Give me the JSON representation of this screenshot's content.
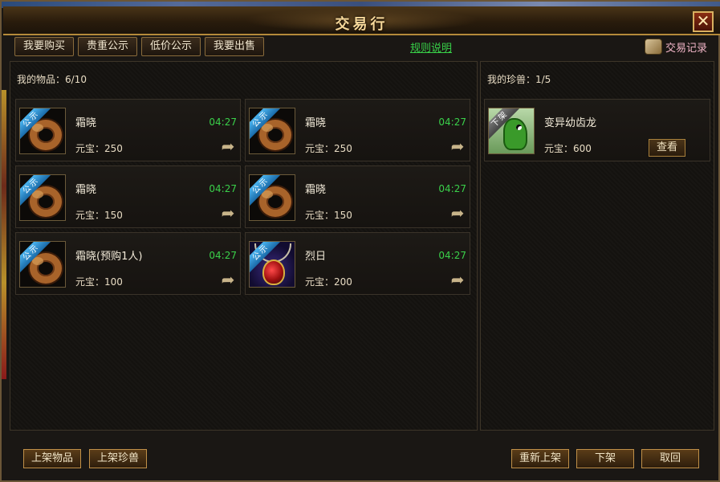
{
  "window": {
    "title": "交易行",
    "close_icon": "close-icon"
  },
  "tabs": [
    {
      "label": "我要购买"
    },
    {
      "label": "贵重公示"
    },
    {
      "label": "低价公示"
    },
    {
      "label": "我要出售"
    }
  ],
  "rules_link": "规则说明",
  "records_label": "交易记录",
  "my_items": {
    "header": "我的物品：6/10",
    "items": [
      {
        "name": "霜晓",
        "time": "04:27",
        "price": "元宝：250",
        "badge": "公示",
        "icon": "ring-icon"
      },
      {
        "name": "霜晓",
        "time": "04:27",
        "price": "元宝：250",
        "badge": "公示",
        "icon": "ring-icon"
      },
      {
        "name": "霜晓",
        "time": "04:27",
        "price": "元宝：150",
        "badge": "公示",
        "icon": "ring-icon"
      },
      {
        "name": "霜晓",
        "time": "04:27",
        "price": "元宝：150",
        "badge": "公示",
        "icon": "ring-icon"
      },
      {
        "name": "霜晓(预购1人)",
        "time": "04:27",
        "price": "元宝：100",
        "badge": "公示",
        "icon": "ring-icon"
      },
      {
        "name": "烈日",
        "time": "04:27",
        "price": "元宝：200",
        "badge": "公示",
        "icon": "necklace-icon"
      }
    ]
  },
  "my_pets": {
    "header": "我的珍兽：1/5",
    "pets": [
      {
        "name": "变异幼齿龙",
        "price": "元宝：600",
        "badge": "下架",
        "view_label": "查看"
      }
    ]
  },
  "bottom": {
    "list_item": "上架物品",
    "list_pet": "上架珍兽",
    "relist": "重新上架",
    "delist": "下架",
    "cancel": "取回"
  },
  "colors": {
    "accent": "#3ad04a",
    "frame": "#b48a3a",
    "link": "#38d048"
  }
}
